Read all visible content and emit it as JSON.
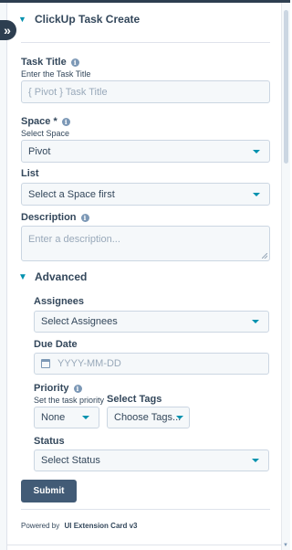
{
  "header": {
    "title": "ClickUp Task Create"
  },
  "task_title": {
    "label": "Task Title",
    "sublabel": "Enter the Task Title",
    "placeholder": "{ Pivot } Task Title"
  },
  "space": {
    "label": "Space *",
    "sublabel": "Select Space",
    "value": "Pivot"
  },
  "list": {
    "label": "List",
    "value": "Select a Space first"
  },
  "description": {
    "label": "Description",
    "placeholder": "Enter a description..."
  },
  "advanced": {
    "title": "Advanced",
    "assignees": {
      "label": "Assignees",
      "value": "Select Assignees"
    },
    "due_date": {
      "label": "Due Date",
      "placeholder": "YYYY-MM-DD"
    },
    "priority": {
      "label": "Priority",
      "sublabel": "Set the task priority",
      "value": "None"
    },
    "tags": {
      "label": "Select Tags",
      "value": "Choose Tags..."
    },
    "status": {
      "label": "Status",
      "value": "Select Status"
    }
  },
  "submit_label": "Submit",
  "footer": {
    "prefix": "Powered by",
    "brand": "UI Extension Card v3"
  },
  "icons": {
    "expand": "double-chevron-right-icon",
    "collapse": "chevron-down-icon",
    "info": "info-icon",
    "dropdown": "caret-down-icon",
    "calendar": "calendar-icon"
  },
  "colors": {
    "accent": "#0091ae",
    "button": "#425b76",
    "text": "#33475b",
    "field_bg": "#f5f8fa",
    "border": "#cbd6e2"
  }
}
